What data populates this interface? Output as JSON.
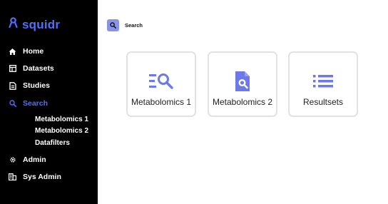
{
  "brand": {
    "name": "squidr",
    "icon": "ribbon-icon",
    "color": "#4f6fff"
  },
  "nav": {
    "items": [
      {
        "label": "Home",
        "icon": "home-icon"
      },
      {
        "label": "Datasets",
        "icon": "table-icon"
      },
      {
        "label": "Studies",
        "icon": "document-icon"
      },
      {
        "label": "Search",
        "icon": "search-icon",
        "active": true
      },
      {
        "label": "Admin",
        "icon": "gear-icon"
      },
      {
        "label": "Sys Admin",
        "icon": "building-icon"
      }
    ],
    "search_children": [
      {
        "label": "Metabolomics 1"
      },
      {
        "label": "Metabolomics 2"
      },
      {
        "label": "Datafilters"
      }
    ]
  },
  "breadcrumb": {
    "icon": "search-icon",
    "label": "Search"
  },
  "cards": [
    {
      "label": "Metabolomics 1",
      "icon": "list-search-icon"
    },
    {
      "label": "Metabolomics 2",
      "icon": "file-search-icon"
    },
    {
      "label": "Resultsets",
      "icon": "list-icon"
    }
  ],
  "colors": {
    "accent": "#4f6fff",
    "icon_accent": "#6d79e6",
    "crumb_bg": "#8893e8",
    "sidebar_bg": "#000000"
  }
}
